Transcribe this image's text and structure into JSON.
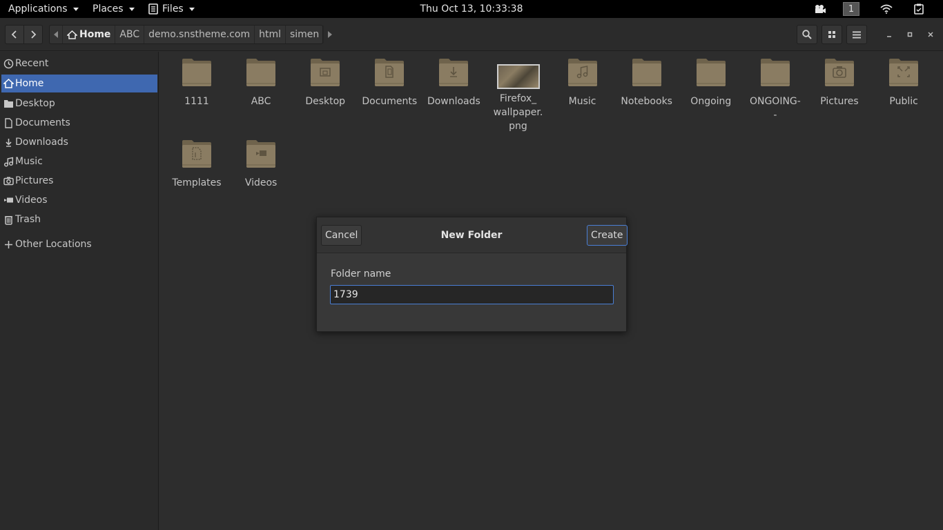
{
  "topbar": {
    "applications_label": "Applications",
    "places_label": "Places",
    "files_label": "Files",
    "clock": "Thu Oct 13, 10:33:38",
    "workspace": "1"
  },
  "toolbar": {
    "breadcrumbs": [
      "Home",
      "ABC",
      "demo.snstheme.com",
      "html",
      "simen"
    ]
  },
  "sidebar": {
    "items": [
      {
        "label": "Recent",
        "icon": "clock-icon"
      },
      {
        "label": "Home",
        "icon": "home-icon",
        "selected": true
      },
      {
        "label": "Desktop",
        "icon": "desktop-folder-icon"
      },
      {
        "label": "Documents",
        "icon": "document-icon"
      },
      {
        "label": "Downloads",
        "icon": "download-icon"
      },
      {
        "label": "Music",
        "icon": "music-note-icon"
      },
      {
        "label": "Pictures",
        "icon": "camera-icon"
      },
      {
        "label": "Videos",
        "icon": "video-icon"
      },
      {
        "label": "Trash",
        "icon": "trash-icon"
      }
    ],
    "other_locations": "Other Locations"
  },
  "files": [
    {
      "name": "1111",
      "type": "folder"
    },
    {
      "name": "ABC",
      "type": "folder"
    },
    {
      "name": "Desktop",
      "type": "folder-desktop"
    },
    {
      "name": "Documents",
      "type": "folder-documents"
    },
    {
      "name": "Downloads",
      "type": "folder-downloads"
    },
    {
      "name": "Firefox_\nwallpaper.\npng",
      "type": "image"
    },
    {
      "name": "Music",
      "type": "folder-music"
    },
    {
      "name": "Notebooks",
      "type": "folder"
    },
    {
      "name": "Ongoing",
      "type": "folder"
    },
    {
      "name": "ONGOING-\n-",
      "type": "folder"
    },
    {
      "name": "Pictures",
      "type": "folder-pictures"
    },
    {
      "name": "Public",
      "type": "folder-public"
    },
    {
      "name": "Templates",
      "type": "folder-templates"
    },
    {
      "name": "Videos",
      "type": "folder-videos"
    }
  ],
  "dialog": {
    "title": "New Folder",
    "cancel_label": "Cancel",
    "create_label": "Create",
    "field_label": "Folder name",
    "field_value": "1739"
  },
  "colors": {
    "accent": "#3f68b0",
    "folder": "#8a7c62"
  }
}
